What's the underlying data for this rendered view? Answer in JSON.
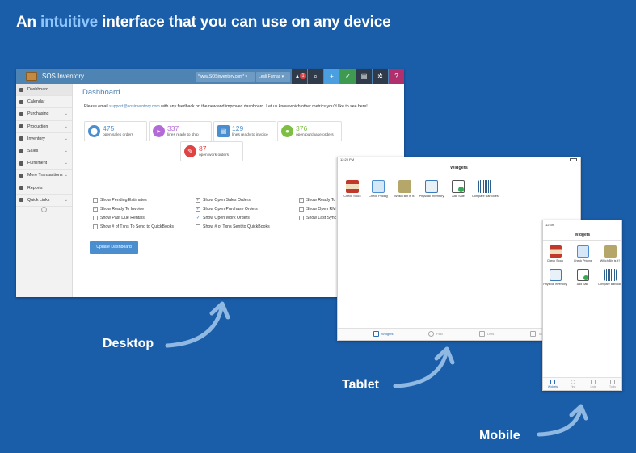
{
  "headline": {
    "part1": "An ",
    "highlight": "intuitive",
    "part2": " interface that you can use on any device"
  },
  "labels": {
    "desktop": "Desktop",
    "tablet": "Tablet",
    "mobile": "Mobile"
  },
  "colors": {
    "background": "#1a5da8",
    "highlight": "#8ec5ff",
    "topbar": "#4d84b3",
    "arrow": "#8fb8e3"
  },
  "desktop": {
    "brand": "SOS Inventory",
    "url": "*www.SOSinventory.com*",
    "user": "Lesli Furnas",
    "notification_count": "1",
    "toolbar_icons": [
      "bell-icon",
      "search-icon",
      "plus-icon",
      "check-icon",
      "print-icon",
      "gear-icon",
      "help-icon"
    ],
    "sidebar": [
      {
        "label": "Dashboard",
        "icon": "dashboard-icon"
      },
      {
        "label": "Calendar",
        "icon": "calendar-icon"
      },
      {
        "label": "Purchasing",
        "icon": "purchasing-icon"
      },
      {
        "label": "Production",
        "icon": "production-icon"
      },
      {
        "label": "Inventory",
        "icon": "inventory-icon"
      },
      {
        "label": "Sales",
        "icon": "sales-icon"
      },
      {
        "label": "Fulfillment",
        "icon": "fulfillment-icon"
      },
      {
        "label": "More Transactions",
        "icon": "transactions-icon"
      },
      {
        "label": "Reports",
        "icon": "reports-icon"
      },
      {
        "label": "Quick Links",
        "icon": "links-icon"
      }
    ],
    "page_title": "Dashboard",
    "message_before": "Please email ",
    "message_link": "support@sosinventory.com",
    "message_after": " with any feedback on the new and improved dashboard. Let us know which other metrics you'd like to see here!",
    "metrics": [
      {
        "value": "475",
        "label": "open sales orders",
        "color": "#4a8ed0"
      },
      {
        "value": "337",
        "label": "lines ready to ship",
        "color": "#b46ad6"
      },
      {
        "value": "129",
        "label": "lines ready to invoice",
        "color": "#4a8ed0"
      },
      {
        "value": "376",
        "label": "open purchase orders",
        "color": "#7cbf42"
      },
      {
        "value": "87",
        "label": "open work orders",
        "color": "#e04343"
      }
    ],
    "checkboxes": [
      {
        "label": "Show Pending Estimates",
        "checked": false
      },
      {
        "label": "Show Ready To Invoice",
        "checked": true
      },
      {
        "label": "Show Past Due Rentals",
        "checked": false
      },
      {
        "label": "Show # of Txns To Send to QuickBooks",
        "checked": false
      },
      {
        "label": "Show Open Sales Orders",
        "checked": true
      },
      {
        "label": "Show Open Purchase Orders",
        "checked": true
      },
      {
        "label": "Show Open Work Orders",
        "checked": true
      },
      {
        "label": "Show # of Txns Sent to QuickBooks",
        "checked": false
      },
      {
        "label": "Show Ready To",
        "checked": true
      },
      {
        "label": "Show Open RM",
        "checked": false
      },
      {
        "label": "Show Last Sync",
        "checked": false
      }
    ],
    "button": "Update Dashboard"
  },
  "tablet": {
    "status_time": "12:20 PM",
    "title": "Widgets",
    "tiles": [
      {
        "label": "Check Stock",
        "icon": "check-stock-icon",
        "color": "#c0392b"
      },
      {
        "label": "Check Pricing",
        "icon": "check-pricing-icon",
        "color": "#4a8ed0"
      },
      {
        "label": "Which Bin is it?",
        "icon": "bin-icon",
        "color": "#b5a66a"
      },
      {
        "label": "Physical Inventory",
        "icon": "physical-inventory-icon",
        "color": "#3a7ab8"
      },
      {
        "label": "Add Sale",
        "icon": "add-sale-icon",
        "color": "#35a853"
      },
      {
        "label": "Compare Barcodes",
        "icon": "barcode-icon",
        "color": "#2d5f8c"
      }
    ],
    "tabs": [
      {
        "label": "Widgets",
        "icon": "widgets-icon"
      },
      {
        "label": "Find",
        "icon": "find-icon"
      },
      {
        "label": "Lists",
        "icon": "lists-icon"
      },
      {
        "label": "Tools",
        "icon": "tools-icon"
      }
    ]
  },
  "mobile": {
    "status_time": "12:39",
    "title": "Widgets",
    "tiles": [
      {
        "label": "Check Stock",
        "icon": "check-stock-icon",
        "color": "#c0392b"
      },
      {
        "label": "Check Pricing",
        "icon": "check-pricing-icon",
        "color": "#4a8ed0"
      },
      {
        "label": "Which Bin is it?",
        "icon": "bin-icon",
        "color": "#b5a66a"
      },
      {
        "label": "Physical Inventory",
        "icon": "physical-inventory-icon",
        "color": "#3a7ab8"
      },
      {
        "label": "Add Sale",
        "icon": "add-sale-icon",
        "color": "#35a853"
      },
      {
        "label": "Compare Barcodes",
        "icon": "barcode-icon",
        "color": "#2d5f8c"
      }
    ],
    "tabs": [
      {
        "label": "Widgets",
        "icon": "widgets-icon"
      },
      {
        "label": "Find",
        "icon": "find-icon"
      },
      {
        "label": "Lists",
        "icon": "lists-icon"
      },
      {
        "label": "Tools",
        "icon": "tools-icon"
      }
    ]
  }
}
